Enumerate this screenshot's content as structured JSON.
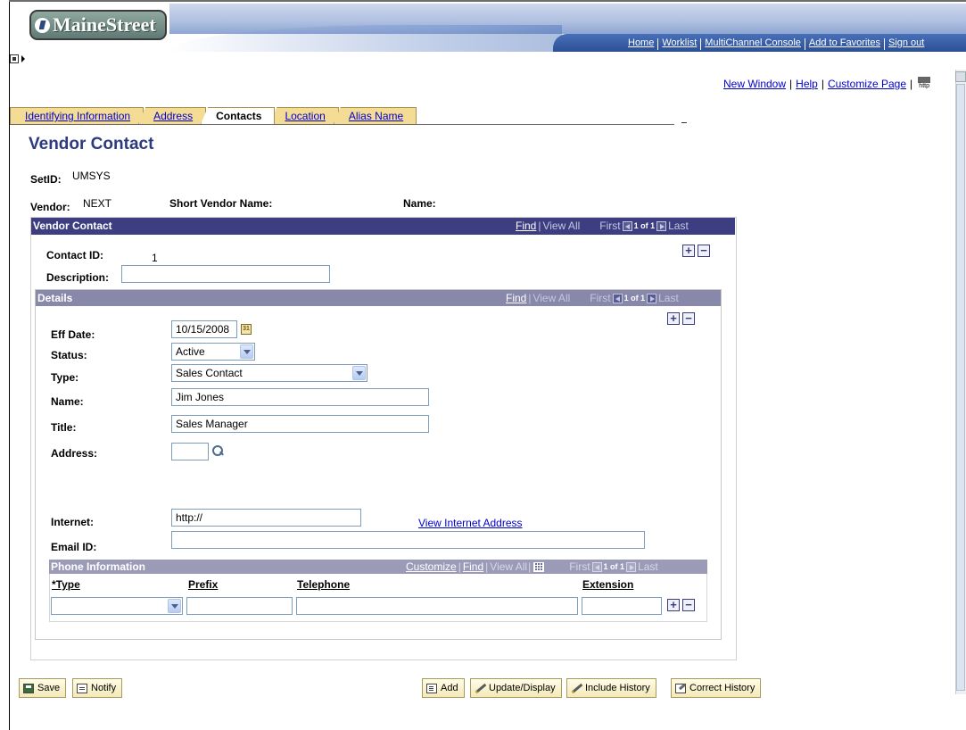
{
  "header": {
    "logo_text": "MaineStreet",
    "nav_links": [
      "Home",
      "Worklist",
      "MultiChannel Console",
      "Add to Favorites",
      "Sign out"
    ]
  },
  "toplinks": {
    "new_window": "New Window",
    "help": "Help",
    "customize_page": "Customize Page",
    "http_icon_text": "http"
  },
  "tabs": [
    {
      "label": "Identifying Information",
      "active": false
    },
    {
      "label": "Address",
      "active": false
    },
    {
      "label": "Contacts",
      "active": true
    },
    {
      "label": "Location",
      "active": false
    },
    {
      "label": "Alias Name",
      "active": false
    }
  ],
  "page_title": "Vendor Contact",
  "setid": {
    "label": "SetID:",
    "value": "UMSYS"
  },
  "vendor": {
    "label": "Vendor:",
    "value": "NEXT"
  },
  "short_vendor_name": {
    "label": "Short Vendor Name:",
    "value": ""
  },
  "name_field": {
    "label": "Name:",
    "value": ""
  },
  "vendor_contact_grid": {
    "title": "Vendor Contact",
    "find": "Find",
    "view_all": "View All",
    "first": "First",
    "count": "1 of 1",
    "last": "Last",
    "contact_id": {
      "label": "Contact ID:",
      "value": "1"
    },
    "description": {
      "label": "Description:",
      "value": ""
    }
  },
  "details_grid": {
    "title": "Details",
    "find": "Find",
    "view_all": "View All",
    "first": "First",
    "count": "1 of 1",
    "last": "Last",
    "eff_date": {
      "label": "Eff Date:",
      "value": "10/15/2008"
    },
    "status": {
      "label": "Status:",
      "value": "Active"
    },
    "type": {
      "label": "Type:",
      "value": "Sales Contact"
    },
    "name": {
      "label": "Name:",
      "value": "Jim Jones"
    },
    "title_field": {
      "label": "Title:",
      "value": "Sales Manager"
    },
    "address": {
      "label": "Address:",
      "value": ""
    },
    "internet": {
      "label": "Internet:",
      "value": "http://"
    },
    "view_internet_address": "View Internet Address",
    "email": {
      "label": "Email ID:",
      "value": ""
    }
  },
  "phone_grid": {
    "title": "Phone Information",
    "customize": "Customize",
    "find": "Find",
    "view_all": "View All",
    "first": "First",
    "count": "1 of 1",
    "last": "Last",
    "columns": [
      "*Type",
      "Prefix",
      "Telephone",
      "Extension"
    ],
    "row": {
      "type": "",
      "prefix": "",
      "telephone": "",
      "extension": ""
    }
  },
  "buttons": {
    "save": "Save",
    "notify": "Notify",
    "add": "Add",
    "update_display": "Update/Display",
    "include_history": "Include History",
    "correct_history": "Correct History"
  },
  "colors": {
    "grid_header": "#3d3d82",
    "details_header": "#8888aa",
    "phone_header": "#9b9bb8",
    "title": "#2c3a7e",
    "tab_inactive": "#f4dc94",
    "link": "#0000cc"
  }
}
